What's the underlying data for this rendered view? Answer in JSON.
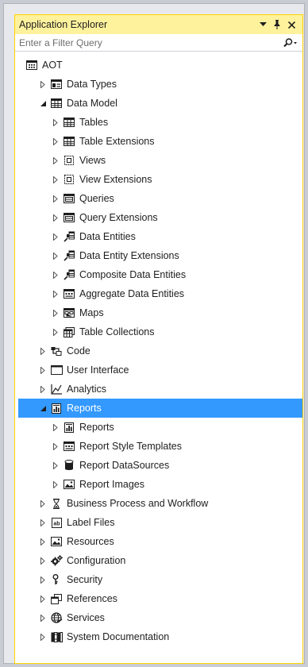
{
  "window": {
    "title": "Application Explorer",
    "filter_placeholder": "Enter a Filter Query"
  },
  "colors": {
    "title_bar": "#fff29d",
    "selection": "#3399ff",
    "panel_border": "#ffd400"
  },
  "tree": {
    "root": {
      "label": "AOT",
      "icon": "aot-icon"
    },
    "items": [
      {
        "label": "Data Types",
        "icon": "data-types-icon",
        "expanded": false
      },
      {
        "label": "Data Model",
        "icon": "grid-icon",
        "expanded": true,
        "children": [
          {
            "label": "Tables",
            "icon": "grid-icon"
          },
          {
            "label": "Table Extensions",
            "icon": "grid-icon"
          },
          {
            "label": "Views",
            "icon": "view-icon"
          },
          {
            "label": "View Extensions",
            "icon": "view-icon"
          },
          {
            "label": "Queries",
            "icon": "query-icon"
          },
          {
            "label": "Query Extensions",
            "icon": "query-icon"
          },
          {
            "label": "Data Entities",
            "icon": "data-entity-icon"
          },
          {
            "label": "Data Entity Extensions",
            "icon": "data-entity-icon"
          },
          {
            "label": "Composite Data Entities",
            "icon": "data-entity-icon"
          },
          {
            "label": "Aggregate Data Entities",
            "icon": "aggregate-icon"
          },
          {
            "label": "Maps",
            "icon": "map-icon"
          },
          {
            "label": "Table Collections",
            "icon": "table-collection-icon"
          }
        ]
      },
      {
        "label": "Code",
        "icon": "code-icon",
        "expanded": false
      },
      {
        "label": "User Interface",
        "icon": "window-icon",
        "expanded": false
      },
      {
        "label": "Analytics",
        "icon": "analytics-icon",
        "expanded": false
      },
      {
        "label": "Reports",
        "icon": "report-icon",
        "expanded": true,
        "selected": true,
        "children": [
          {
            "label": "Reports",
            "icon": "report-icon"
          },
          {
            "label": "Report Style Templates",
            "icon": "aggregate-icon"
          },
          {
            "label": "Report DataSources",
            "icon": "database-icon"
          },
          {
            "label": "Report Images",
            "icon": "image-icon"
          }
        ]
      },
      {
        "label": "Business Process and Workflow",
        "icon": "hourglass-icon",
        "expanded": false
      },
      {
        "label": "Label Files",
        "icon": "label-icon",
        "expanded": false
      },
      {
        "label": "Resources",
        "icon": "image-icon",
        "expanded": false
      },
      {
        "label": "Configuration",
        "icon": "gear-icon",
        "expanded": false
      },
      {
        "label": "Security",
        "icon": "key-icon",
        "expanded": false
      },
      {
        "label": "References",
        "icon": "references-icon",
        "expanded": false
      },
      {
        "label": "Services",
        "icon": "globe-icon",
        "expanded": false
      },
      {
        "label": "System Documentation",
        "icon": "books-icon",
        "expanded": false
      }
    ]
  }
}
